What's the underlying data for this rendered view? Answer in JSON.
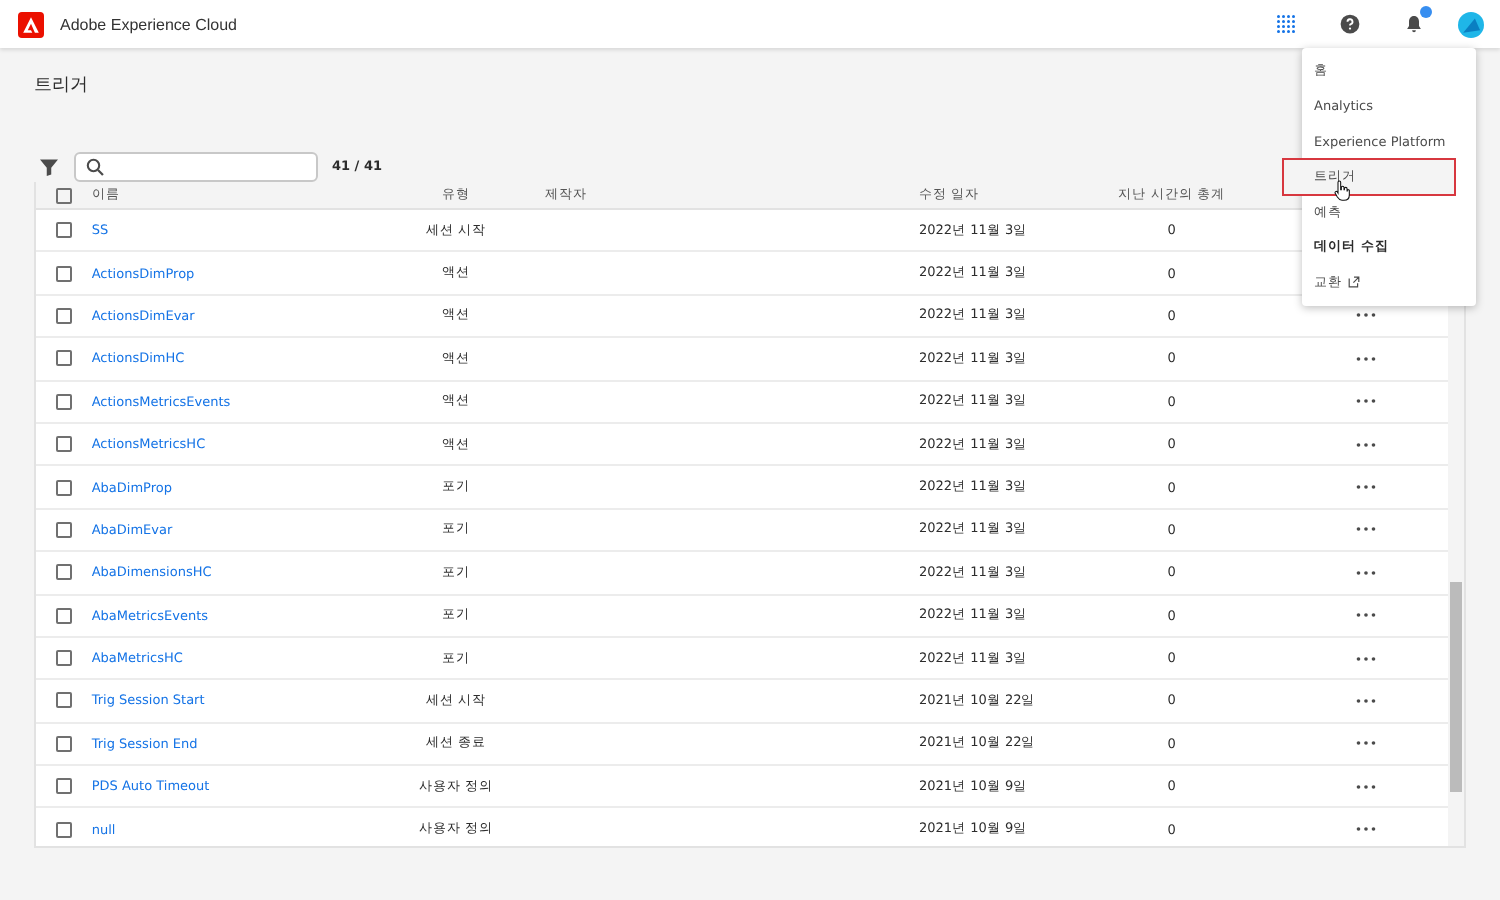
{
  "header": {
    "product": "Adobe Experience Cloud",
    "notifications_badge": true
  },
  "page": {
    "title": "트리거"
  },
  "filter": {
    "count": "41",
    "separator": "/",
    "total": "41"
  },
  "table": {
    "select_all_checked": false,
    "columns": [
      "이름",
      "유형",
      "제작자",
      "수정 일자",
      "지난 시간의 총계"
    ],
    "rows": [
      {
        "checked": false,
        "name": "SS",
        "type": "세션 시작",
        "date": "2022년 11월 3일",
        "total": "0"
      },
      {
        "checked": false,
        "name": "ActionsDimProp",
        "type": "액션",
        "date": "2022년 11월 3일",
        "total": "0"
      },
      {
        "checked": false,
        "name": "ActionsDimEvar",
        "type": "액션",
        "date": "2022년 11월 3일",
        "total": "0"
      },
      {
        "checked": false,
        "name": "ActionsDimHC",
        "type": "액션",
        "date": "2022년 11월 3일",
        "total": "0"
      },
      {
        "checked": false,
        "name": "ActionsMetricsEvents",
        "type": "액션",
        "date": "2022년 11월 3일",
        "total": "0"
      },
      {
        "checked": false,
        "name": "ActionsMetricsHC",
        "type": "액션",
        "date": "2022년 11월 3일",
        "total": "0"
      },
      {
        "checked": false,
        "name": "AbaDimProp",
        "type": "포기",
        "date": "2022년 11월 3일",
        "total": "0"
      },
      {
        "checked": false,
        "name": "AbaDimEvar",
        "type": "포기",
        "date": "2022년 11월 3일",
        "total": "0"
      },
      {
        "checked": false,
        "name": "AbaDimensionsHC",
        "type": "포기",
        "date": "2022년 11월 3일",
        "total": "0"
      },
      {
        "checked": false,
        "name": "AbaMetricsEvents",
        "type": "포기",
        "date": "2022년 11월 3일",
        "total": "0"
      },
      {
        "checked": false,
        "name": "AbaMetricsHC",
        "type": "포기",
        "date": "2022년 11월 3일",
        "total": "0"
      },
      {
        "checked": false,
        "name": "Trig Session Start",
        "type": "세션 시작",
        "date": "2021년 10월 22일",
        "total": "0"
      },
      {
        "checked": false,
        "name": "Trig Session End",
        "type": "세션 종료",
        "date": "2021년 10월 22일",
        "total": "0"
      },
      {
        "checked": false,
        "name": "PDS Auto Timeout",
        "type": "사용자 정의",
        "date": "2021년 10월 9일",
        "total": "0"
      },
      {
        "checked": false,
        "name": "null",
        "type": "사용자 정의",
        "date": "2021년 10월 9일",
        "total": "0"
      }
    ]
  },
  "app_menu": {
    "items": [
      {
        "label": "홈",
        "kind": "plain",
        "selected": false
      },
      {
        "label": "Analytics",
        "kind": "plain",
        "selected": false
      },
      {
        "label": "Experience Platform",
        "kind": "plain",
        "selected": false
      },
      {
        "label": "트리거",
        "kind": "plain",
        "selected": true
      },
      {
        "label": "예측",
        "kind": "plain",
        "selected": false
      },
      {
        "label": "데이터 수집",
        "kind": "heading",
        "selected": false
      },
      {
        "label": "교환",
        "kind": "external",
        "selected": false
      }
    ]
  }
}
